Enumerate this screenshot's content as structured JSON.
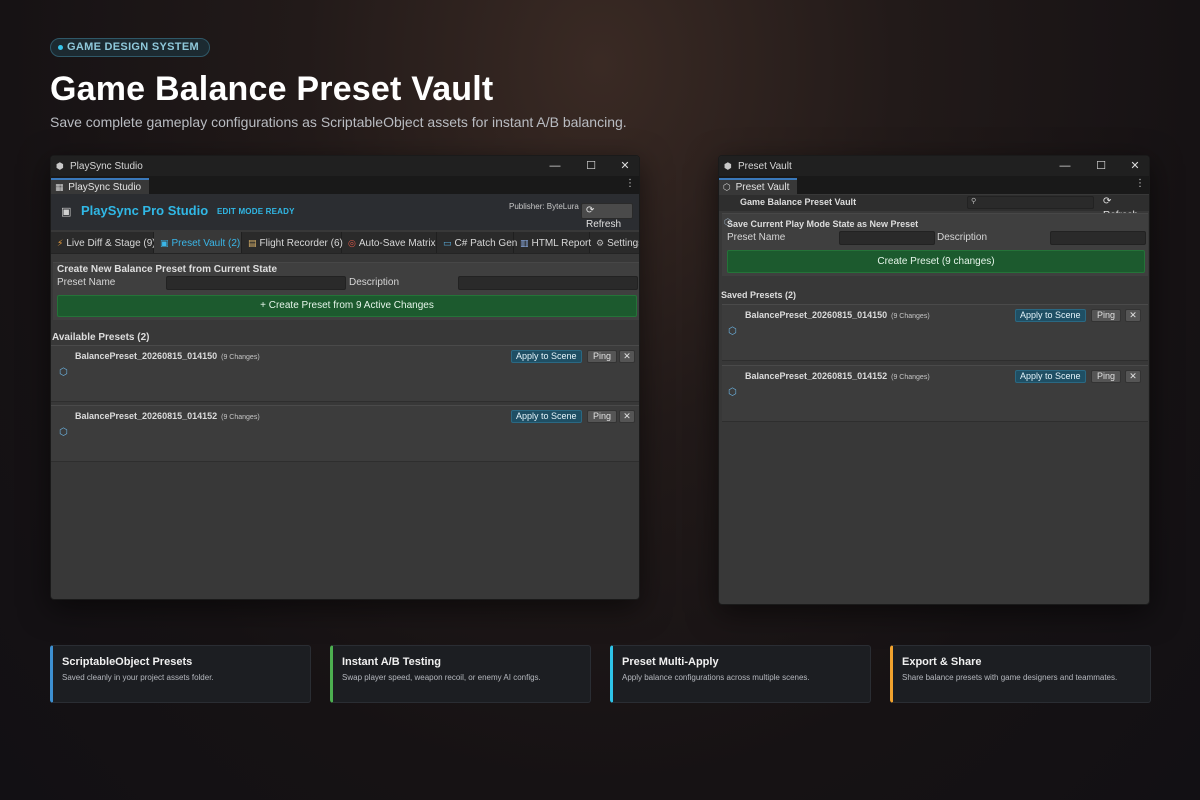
{
  "hero": {
    "pill": "GAME DESIGN SYSTEM",
    "title": "Game Balance Preset Vault",
    "subtitle": "Save complete gameplay configurations as ScriptableObject assets for instant A/B balancing."
  },
  "left_window": {
    "title": "PlaySync Studio",
    "dock_tab": "PlaySync Studio",
    "brand": "PlaySync Pro Studio",
    "mode_badge": "EDIT MODE READY",
    "publisher": "Publisher: ByteLura",
    "refresh": "Refresh",
    "tabs": [
      {
        "icon": "⚡",
        "label": "Live Diff & Stage (9)"
      },
      {
        "icon": "▣",
        "label": "Preset Vault (2)"
      },
      {
        "icon": "▤",
        "label": "Flight Recorder (6)"
      },
      {
        "icon": "◎",
        "label": "Auto-Save Matrix"
      },
      {
        "icon": "▭",
        "label": "C# Patch Gen"
      },
      {
        "icon": "▥",
        "label": "HTML Report"
      },
      {
        "icon": "⚙",
        "label": "Settings"
      }
    ],
    "create_section_title": "Create New Balance Preset from Current State",
    "preset_name_label": "Preset Name",
    "description_label": "Description",
    "create_button": "+ Create Preset from 9 Active Changes",
    "available_title": "Available Presets (2)",
    "presets": [
      {
        "name": "BalancePreset_20260815_014150",
        "count": "(9 Changes)"
      },
      {
        "name": "BalancePreset_20260815_014152",
        "count": "(9 Changes)"
      }
    ],
    "apply_label": "Apply to Scene",
    "ping_label": "Ping",
    "remove_label": "✕"
  },
  "right_window": {
    "title": "Preset Vault",
    "dock_tab": "Preset Vault",
    "toolbar_title": "Game Balance Preset Vault",
    "search_placeholder": "",
    "refresh": "Refresh",
    "save_title": "Save Current Play Mode State as New Preset",
    "preset_name_label": "Preset Name",
    "description_label": "Description",
    "create_button": "Create Preset (9 changes)",
    "saved_title": "Saved Presets (2)",
    "presets": [
      {
        "name": "BalancePreset_20260815_014150",
        "count": "(9 Changes)"
      },
      {
        "name": "BalancePreset_20260815_014152",
        "count": "(9 Changes)"
      }
    ],
    "apply_label": "Apply to Scene",
    "ping_label": "Ping",
    "remove_label": "✕"
  },
  "features": [
    {
      "title": "ScriptableObject Presets",
      "desc": "Saved cleanly in your project assets folder.",
      "accent": "#3d8fd0"
    },
    {
      "title": "Instant A/B Testing",
      "desc": "Swap player speed, weapon recoil, or enemy AI configs.",
      "accent": "#4caf50"
    },
    {
      "title": "Preset Multi-Apply",
      "desc": "Apply balance configurations across multiple scenes.",
      "accent": "#2ec3e8"
    },
    {
      "title": "Export & Share",
      "desc": "Share balance presets with game designers and teammates.",
      "accent": "#f0a22e"
    }
  ]
}
